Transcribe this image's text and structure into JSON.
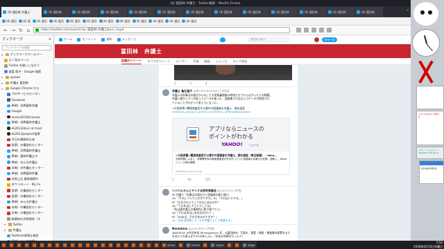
{
  "window": {
    "title": "(8) 冨田林 弁護士 - Twitter検索 - Mozilla Firefox"
  },
  "tabs": [
    {
      "label": "(8) 冨田林 弁護士",
      "active": true
    },
    {
      "label": "(8) 冨田林"
    },
    {
      "label": "(8) 冨田林"
    },
    {
      "label": "(8) 冨田林"
    },
    {
      "label": "(8) 冨田林"
    },
    {
      "label": "(8) 冨田林"
    },
    {
      "label": "(8) 冨田林"
    },
    {
      "label": "(8) 冨田林"
    },
    {
      "label": "(8) 冨田林"
    },
    {
      "label": "(8) 冨田林"
    },
    {
      "label": "(8) 冨田林"
    },
    {
      "label": "(8) 冨田林"
    },
    {
      "label": "(8) 冨田林"
    }
  ],
  "bookmarks_toolbar": [
    {
      "label": "(8) 冨田"
    },
    {
      "label": "(8) 冨"
    },
    {
      "label": "(8) 冨田"
    },
    {
      "label": "(8) 冨田"
    },
    {
      "label": "(8) 冨田"
    },
    {
      "label": "(8) 冨田"
    },
    {
      "label": "(8) 冨田"
    },
    {
      "label": "(8) 冨田"
    },
    {
      "label": "(8) 冨田"
    },
    {
      "label": "(8) 冨田"
    },
    {
      "label": "(8) 冨田"
    },
    {
      "label": "(8) 冨田"
    }
  ],
  "urlbar": {
    "value": "https://twitter.com/search?q=冨田林 弁護士&src=typd"
  },
  "sidebar": {
    "title": "ブックマーク",
    "close": "×",
    "search_placeholder": "ブックマークを検索",
    "items": [
      {
        "label": "ブックマークツールバー",
        "icon": "folder",
        "indent": 0
      },
      {
        "label": "よく見るページ",
        "icon": "star",
        "indent": 1
      },
      {
        "label": "Firefox を使いこなそう",
        "icon": "generic",
        "indent": 1
      },
      {
        "label": "速度 萌子 - Google 検索",
        "icon": "g",
        "indent": 1
      },
      {
        "label": "upload",
        "icon": "folder",
        "indent": 0
      },
      {
        "label": "弁護士 冨田林",
        "icon": "folder",
        "indent": 0
      },
      {
        "label": "Google Chrome から",
        "icon": "folder",
        "indent": 0
      },
      {
        "label": "プロサービスセンター",
        "icon": "blue2",
        "indent": 2
      },
      {
        "label": "Facebook",
        "icon": "fb",
        "indent": 2
      },
      {
        "label": "奉納）炎降冨林弁護",
        "icon": "tw",
        "indent": 2
      },
      {
        "label": "Google",
        "icon": "g",
        "indent": 2
      },
      {
        "label": "hirono2016hironota",
        "icon": "gh",
        "indent": 2
      },
      {
        "label": "奉納）炎降冨林弁護士",
        "icon": "tw",
        "indent": 2
      },
      {
        "label": "kk2013/docs at mast",
        "icon": "gh",
        "indent": 2
      },
      {
        "label": "kk2013/project/投票",
        "icon": "gh",
        "indent": 2
      },
      {
        "label": "今日の事務所以来",
        "icon": "red",
        "indent": 2
      },
      {
        "label": "投票）の構造化センター",
        "icon": "red",
        "indent": 2
      },
      {
        "label": "奉納）炎降冨林弁護士",
        "icon": "tw",
        "indent": 2
      },
      {
        "label": "奉納）冨林弁護士ホ",
        "icon": "tw",
        "indent": 2
      },
      {
        "label": "奉納：みんな弁護士",
        "icon": "tw",
        "indent": 2
      },
      {
        "label": "炎毎）の弁護士センター",
        "icon": "red",
        "indent": 2
      },
      {
        "label": "奉納）炎降冨林弁護",
        "icon": "tw",
        "indent": 2
      },
      {
        "label": "非常上位 最高検察庁",
        "icon": "red",
        "indent": 2
      },
      {
        "label": "ダウンロード - My Fo",
        "icon": "yel",
        "indent": 2
      },
      {
        "label": "投票）の構造化センター",
        "icon": "red",
        "indent": 2
      },
      {
        "label": "投票）の構造化センター",
        "icon": "red",
        "indent": 2
      },
      {
        "label": "奉納）みんな弁護士",
        "icon": "tw",
        "indent": 2
      },
      {
        "label": "炎毎）の構造化センター",
        "icon": "red",
        "indent": 2
      },
      {
        "label": "炎毎）の構造化センター",
        "icon": "red",
        "indent": 2
      },
      {
        "label": "総督府の大統領府（ホ",
        "icon": "generic",
        "indent": 2
      },
      {
        "label": "Twitter",
        "icon": "folder",
        "indent": 1
      },
      {
        "label": "弁護士",
        "icon": "folder",
        "indent": 1
      },
      {
        "label": "Twitterの表現な検索",
        "icon": "tw",
        "indent": 2
      },
      {
        "label": "奉納）みんな弁護士",
        "icon": "tw",
        "indent": 2
      },
      {
        "label": "非常上位 最高検察庁",
        "icon": "red",
        "indent": 2
      },
      {
        "label": "奉納）みんな弁護士",
        "icon": "tw",
        "indent": 2
      },
      {
        "label": "グループ",
        "icon": "folder",
        "indent": 1
      }
    ]
  },
  "twitter": {
    "nav": [
      {
        "label": "ホーム"
      },
      {
        "label": "モーメント"
      },
      {
        "label": "通知"
      },
      {
        "label": "メッセージ"
      }
    ],
    "search_value": "冨田林 弁護士",
    "tweet_button": "ツイート",
    "banner_name": "冨田林　弁護士",
    "subnav": [
      {
        "label": "話題のツイート",
        "active": true
      },
      {
        "label": "すべてのツイート"
      },
      {
        "label": "ユーザー"
      },
      {
        "label": "写真"
      },
      {
        "label": "動画"
      },
      {
        "label": "ニュース"
      },
      {
        "label": "ライブ放送"
      }
    ],
    "action_counts": [
      "1",
      "2",
      "4"
    ],
    "tweets": [
      {
        "name": "弁護士 亀石倫子",
        "handle": "@MichikoKameishi",
        "time": "12時間",
        "body": [
          "弁護人の刑事法の部分からのことを密接審理後の呼吸させてもらなかったとの問題。",
          "弁護人側からアリが取ってデータを使った、追跡捜丁が全ならゴデータが削除され",
          "ていることが分かって差らうになった。",
          "",
          "<大阪府警>覆面検査官が公電中の容疑者を弁護士、顔を認証",
          "headlines.yahoo.co.jp/hl?a=20180614...@YahooNewsTopics"
        ],
        "card": {
          "line1": "アプリならニュースの",
          "line2": "ポイントがわかる",
          "brand": "YAHOO!",
          "brand_sub": "ニュース",
          "title": "<大阪府警>覆面検査官が公電中の容疑者を弁護士、顔を認証（毎日新聞） - Yaho...",
          "desc": "大阪府警によると、府警察所有の覆面捜査官が先月行っていた容疑者の弁護士の任務、追跡し、Yahooニュース他の新聞",
          "domain": "headlines.yahoo.co.jp"
        },
        "actions": [
          "2",
          "60",
          "101"
        ]
      },
      {
        "name": "シジジムちんとヤリクま研究承認会",
        "handle": "@yakandra",
        "time": "1時間",
        "body": [
          "RT 弁護人「刑事法の部分から容疑者の取り調べ、",
          "#s 「それについていかがですか」#s 「それはいいです。」",
          "RT「なる方もいうことの方にあるのか？",
          "#s「でも本当にそういうことは」",
          "「私は真弁護士の事務所に取り調べてい」",
          "#s「それは本当に本当なのかい？」",
          "RT「#s本当、それがあるのですか？」",
          "#s「自分は所属して、その弁護人として検査する」"
        ],
        "actions": [
          "",
          "",
          ""
        ]
      },
      {
        "name": "Neulobize",
        "handle": "@neulobize",
        "time": "12時間",
        "body": [
          "WANTED!! #炎田市長 @hiroyakashu 氏、#冨田林市、写真を、探索・取組・捜査陣の配置をまた",
          "をあえての表示まで2018年に示し（市長の判断を行った人）"
        ],
        "actions": [
          "",
          "",
          ""
        ]
      }
    ]
  },
  "desktop": {
    "widget_text_1": "0:40 2018/6/1 夏祭りの",
    "widget_text_2": "スクリーンショット 2018/6/13 06:00:11",
    "screenshot_title": "screenShot"
  },
  "taskbar": {
    "items": [
      {
        "label": "",
        "icon": "generic"
      },
      {
        "label": "",
        "icon": "generic"
      },
      {
        "label": "",
        "icon": "generic"
      },
      {
        "label": "",
        "icon": "generic"
      },
      {
        "label": "",
        "icon": "generic"
      },
      {
        "label": "",
        "icon": "generic"
      },
      {
        "label": "",
        "icon": "generic"
      },
      {
        "label": "",
        "icon": "generic"
      },
      {
        "label": "",
        "icon": "generic"
      },
      {
        "label": "",
        "icon": "generic"
      },
      {
        "label": "",
        "icon": "generic"
      },
      {
        "label": "",
        "icon": "generic"
      },
      {
        "label": "",
        "icon": "generic"
      },
      {
        "label": "",
        "icon": "generic"
      },
      {
        "label": "",
        "icon": "generic"
      },
      {
        "label": "",
        "icon": "generic"
      },
      {
        "label": "",
        "icon": "generic"
      },
      {
        "label": "",
        "icon": "generic"
      },
      {
        "label": "",
        "icon": "generic"
      },
      {
        "label": "",
        "icon": "generic"
      },
      {
        "label": "",
        "icon": "generic"
      },
      {
        "label": "sense",
        "icon": "ff"
      },
      {
        "label": "",
        "icon": "generic"
      },
      {
        "label": "sclock",
        "icon": "gen"
      },
      {
        "label": "",
        "icon": "generic"
      },
      {
        "label": "xeyes",
        "icon": "gen"
      },
      {
        "label": "",
        "icon": "generic"
      },
      {
        "label": "",
        "icon": "generic"
      },
      {
        "label": "xlogo",
        "icon": "gen"
      }
    ],
    "clock_time": "5:54",
    "clock_date": "2018年6月14日木曜日"
  }
}
